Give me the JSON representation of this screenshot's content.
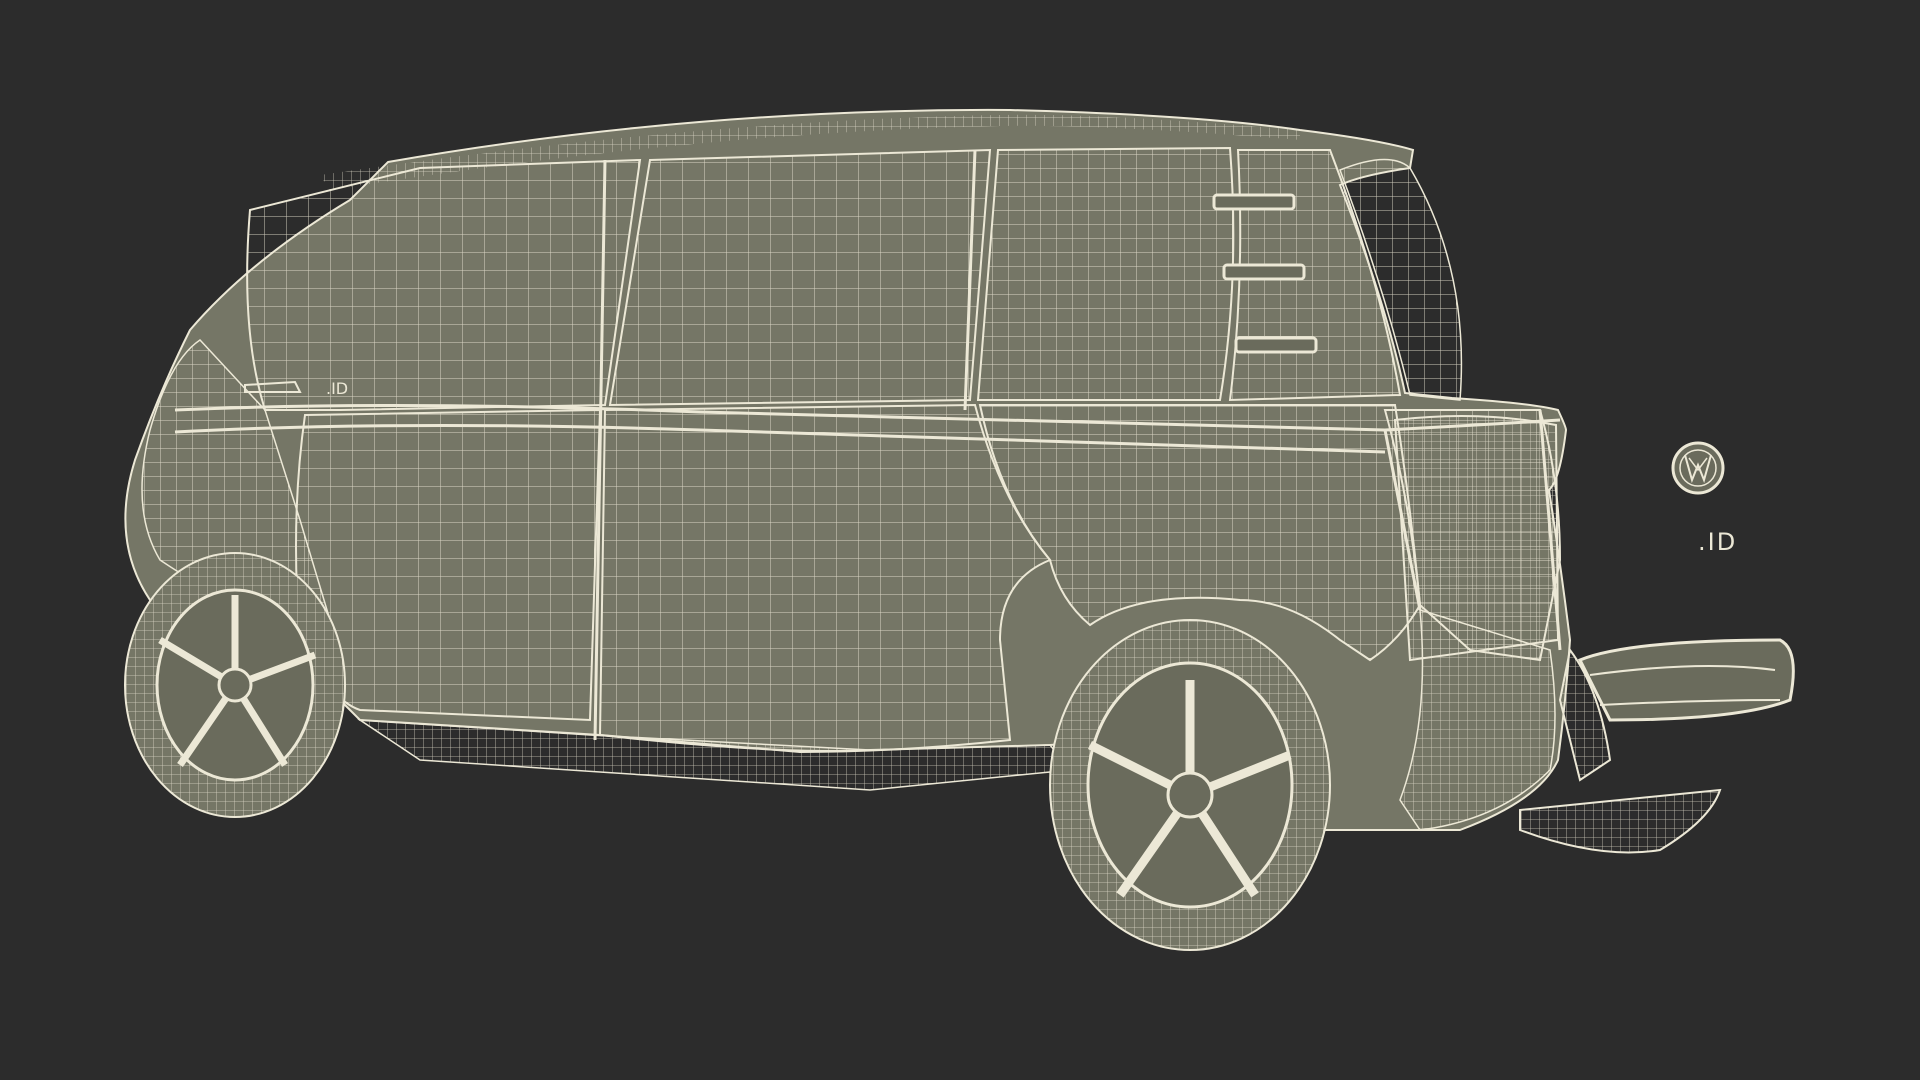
{
  "scene": {
    "subject": "wireframe-van-render",
    "background_color": "#2c2c2c",
    "body_fill": "#757666",
    "wire_color": "#ece8d6"
  },
  "badge": {
    "rear_text": ".ID",
    "logo_letters": "VW"
  }
}
